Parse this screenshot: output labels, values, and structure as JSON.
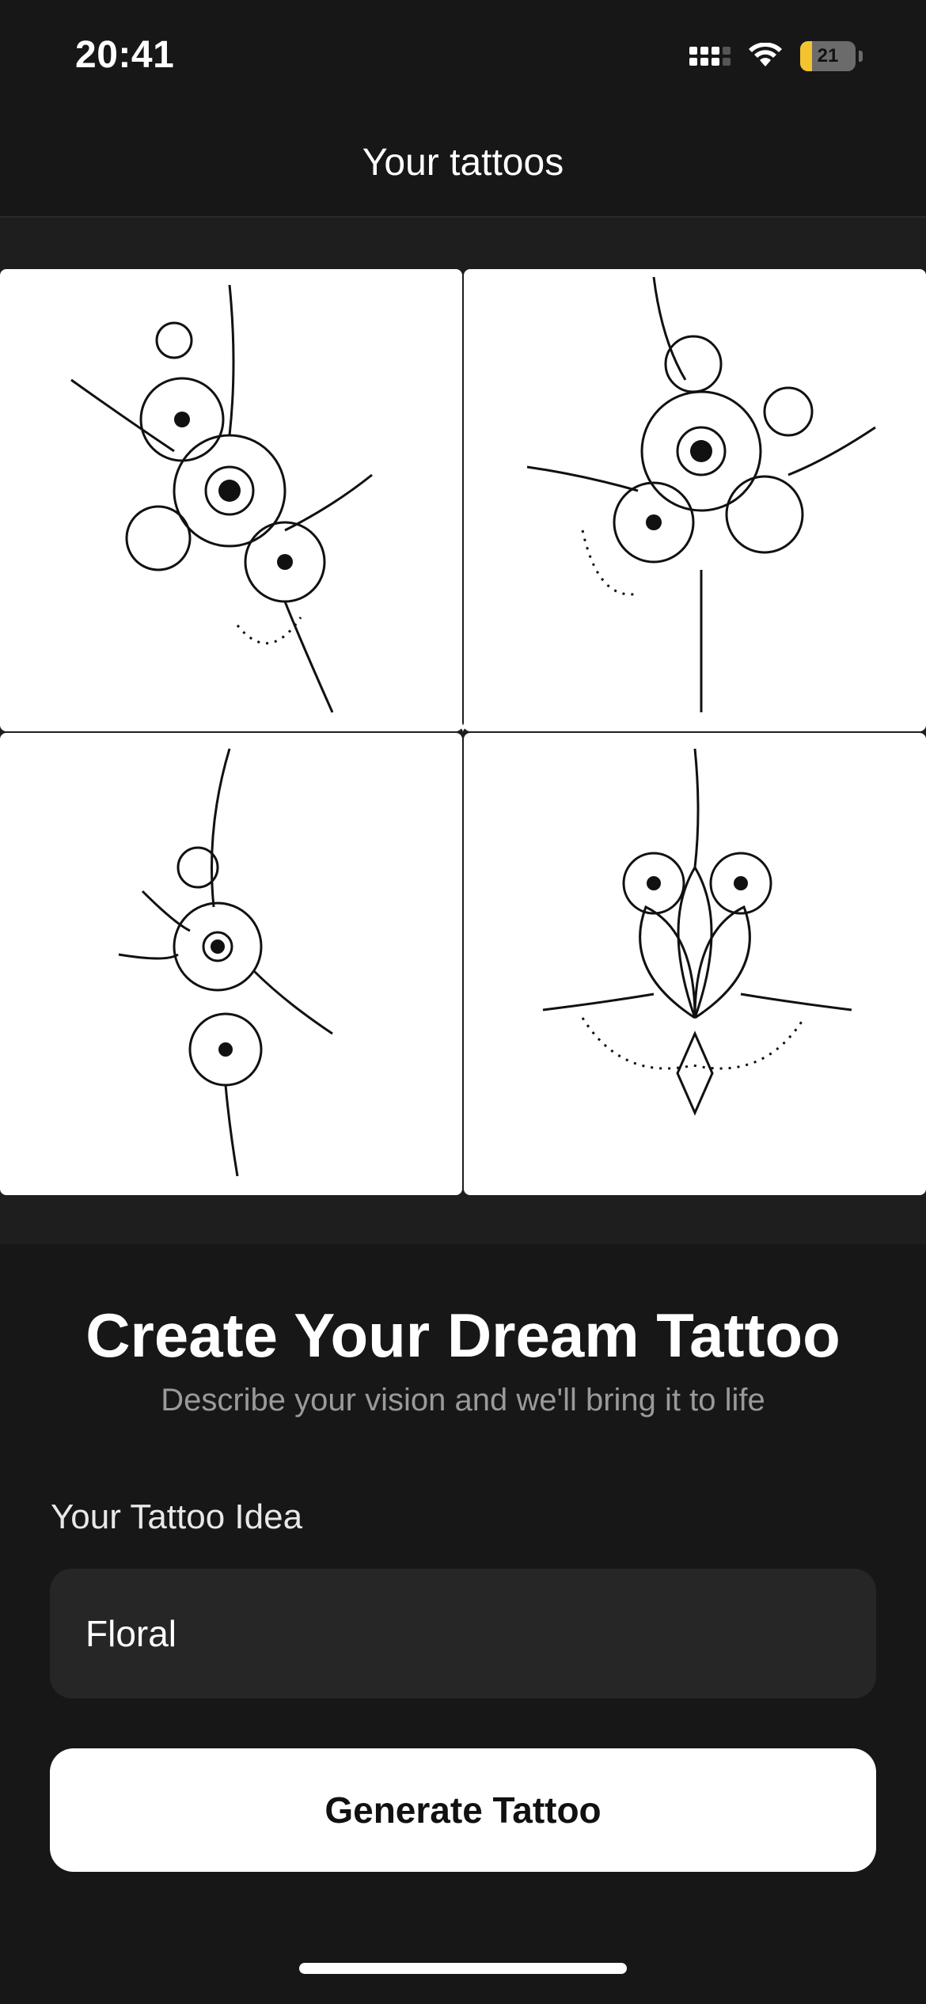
{
  "status": {
    "time": "20:41",
    "battery_percent": "21",
    "battery_level": 0.21
  },
  "nav": {
    "title": "Your tattoos"
  },
  "gallery": {
    "items": [
      {
        "icon": "floral-tattoo-design"
      },
      {
        "icon": "floral-tattoo-design"
      },
      {
        "icon": "floral-tattoo-design"
      },
      {
        "icon": "floral-tattoo-design"
      }
    ]
  },
  "form": {
    "headline": "Create Your Dream Tattoo",
    "subtitle": "Describe your vision and we'll bring it to life",
    "idea_label": "Your Tattoo Idea",
    "idea_value": "Floral",
    "generate_label": "Generate Tattoo"
  },
  "colors": {
    "background": "#171717",
    "panel": "#1e1e1e",
    "field": "#262626",
    "battery": "#f4c430"
  }
}
